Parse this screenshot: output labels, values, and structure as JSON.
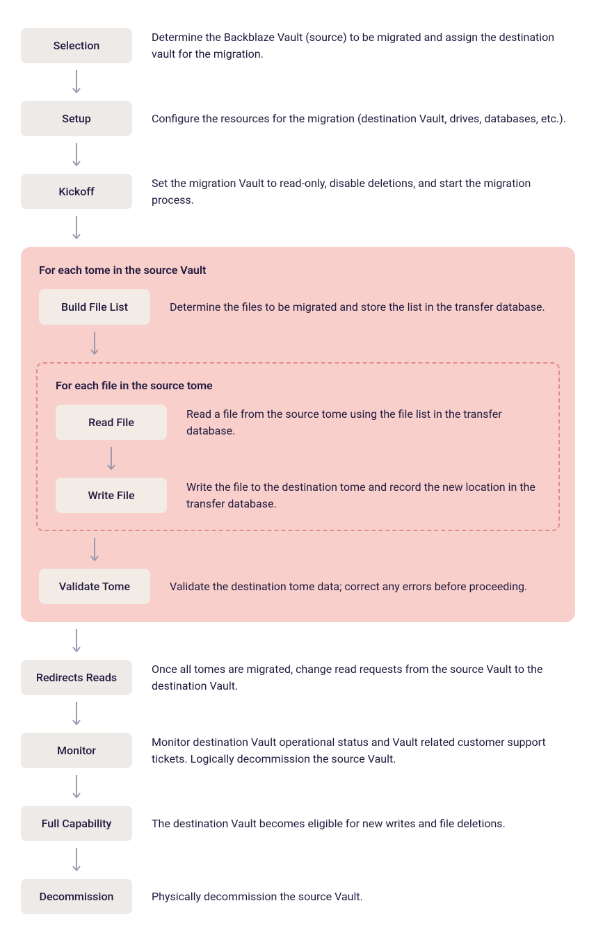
{
  "steps": {
    "selection": {
      "label": "Selection",
      "desc": "Determine the Backblaze Vault (source) to be migrated and assign the destination vault for the migration."
    },
    "setup": {
      "label": "Setup",
      "desc": "Configure the resources for the migration (destination Vault, drives, databases, etc.)."
    },
    "kickoff": {
      "label": "Kickoff",
      "desc": "Set the migration Vault to read-only, disable deletions, and start the migration process."
    },
    "build_list": {
      "label": "Build File List",
      "desc": "Determine the files to be migrated and store the list in the transfer database."
    },
    "read_file": {
      "label": "Read File",
      "desc": "Read a file from the source tome using the file list in the transfer database."
    },
    "write_file": {
      "label": "Write File",
      "desc": "Write the file to the destination tome and record the new location in the transfer database."
    },
    "validate": {
      "label": "Validate Tome",
      "desc": "Validate the destination tome data; correct any errors before proceeding."
    },
    "redirect": {
      "label": "Redirects Reads",
      "desc": "Once all tomes are migrated, change read requests from the source Vault to the destination Vault."
    },
    "monitor": {
      "label": "Monitor",
      "desc": "Monitor destination Vault operational status and Vault related customer support tickets. Logically decommission the source Vault."
    },
    "full_cap": {
      "label": "Full Capability",
      "desc": "The destination Vault becomes eligible for new writes and file deletions."
    },
    "decommission": {
      "label": "Decommission",
      "desc": "Physically decommission the source Vault."
    }
  },
  "loops": {
    "outer_title": "For each tome in the source Vault",
    "inner_title": "For each file in the source tome"
  }
}
